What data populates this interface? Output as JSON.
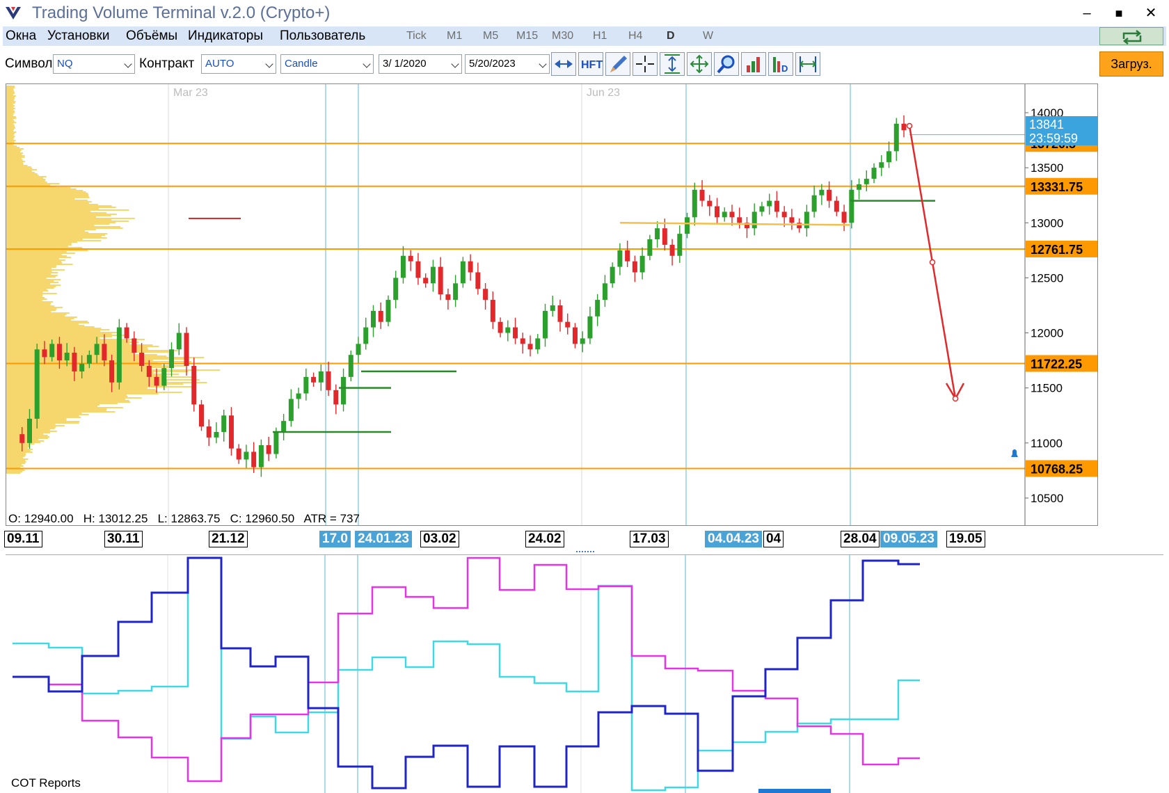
{
  "window": {
    "title": "Trading Volume Terminal v.2.0 (Crypto+)",
    "minimize": "–",
    "maximize": "■",
    "close": "✕"
  },
  "menu": {
    "items": [
      "Окна",
      "Установки",
      "Объёмы",
      "Индикаторы",
      "Пользователь"
    ],
    "timeframes": [
      "Tick",
      "M1",
      "M5",
      "M15",
      "M30",
      "H1",
      "H4",
      "D",
      "W"
    ],
    "active_timeframe": "D"
  },
  "toolbar": {
    "symbol_label": "Символ",
    "symbol_value": "NQ",
    "contract_label": "Контракт",
    "contract_value": "AUTO",
    "chart_type": "Candle",
    "date_from": "3/  1/2020",
    "date_to": "5/20/2023",
    "hft_label": "HFT",
    "load_button": "Загруз.",
    "tool_icons": [
      "replay-icon",
      "hft-icon",
      "pencil-icon",
      "crosshair-icon",
      "vertical-fit-icon",
      "move-icon",
      "zoom-icon",
      "volume-bars-icon",
      "delta-icon",
      "measure-icon"
    ]
  },
  "colors": {
    "up": "#2ca02c",
    "down": "#e2282b",
    "level": "#ff9900",
    "profile": "#f5d76e",
    "cursor_line": "#5bb7d6",
    "series_navy": "#1f24c7",
    "series_magenta": "#e633e6",
    "series_cyan": "#3fd8e6"
  },
  "main_chart": {
    "month_labels": [
      "Mar 23",
      "Jun 23"
    ],
    "y_ticks": [
      14000,
      13500,
      13000,
      12500,
      12000,
      11500,
      11000,
      10500
    ],
    "level_labels": [
      {
        "value": 13720.5,
        "text": "13720.5"
      },
      {
        "value": 13331.75,
        "text": "13331.75"
      },
      {
        "value": 12761.75,
        "text": "12761.75"
      },
      {
        "value": 11722.25,
        "text": "11722.25"
      },
      {
        "value": 10768.25,
        "text": "10768.25"
      }
    ],
    "price_tag": {
      "price": "13841",
      "time": "23:59:59"
    },
    "ohlc": {
      "open_label": "O:",
      "open": "12940.00",
      "high_label": "H:",
      "high": "13012.25",
      "low_label": "L:",
      "low": "12863.75",
      "close_label": "C:",
      "close": "12960.50",
      "atr_label": "ATR =",
      "atr": "737"
    },
    "candle_closes": [
      11080,
      11000,
      11220,
      11850,
      11780,
      11900,
      11750,
      11820,
      11650,
      11720,
      11800,
      11900,
      11750,
      11550,
      12050,
      11950,
      11820,
      11700,
      11600,
      11520,
      11680,
      11850,
      12000,
      11700,
      11350,
      11150,
      11050,
      11100,
      11250,
      10950,
      10850,
      10920,
      10780,
      10980,
      10900,
      11100,
      11200,
      11400,
      11450,
      11600,
      11550,
      11650,
      11480,
      11350,
      11600,
      11800,
      11900,
      12050,
      12200,
      12100,
      12300,
      12500,
      12700,
      12650,
      12500,
      12450,
      12600,
      12350,
      12300,
      12450,
      12650,
      12550,
      12400,
      12300,
      12100,
      12000,
      12050,
      11950,
      11900,
      11850,
      11950,
      12200,
      12250,
      12100,
      12050,
      11900,
      11950,
      12150,
      12300,
      12450,
      12600,
      12750,
      12650,
      12550,
      12700,
      12850,
      12950,
      12800,
      12700,
      12900,
      13050,
      13300,
      13200,
      13150,
      13050,
      13100,
      13050,
      13000,
      12950,
      13100,
      13150,
      13200,
      13100,
      13050,
      13000,
      12950,
      13100,
      13250,
      13300,
      13200,
      13100,
      13000,
      13300,
      13350,
      13400,
      13500,
      13550,
      13650,
      13900,
      13841
    ]
  },
  "date_strip": [
    {
      "text": "09.11",
      "hl": false
    },
    {
      "text": "30.11",
      "hl": false
    },
    {
      "text": "21.12",
      "hl": false
    },
    {
      "text": "17.0",
      "hl": true
    },
    {
      "text": "24.01.23",
      "hl": true
    },
    {
      "text": "03.02",
      "hl": false
    },
    {
      "text": "24.02",
      "hl": false
    },
    {
      "text": "17.03",
      "hl": false
    },
    {
      "text": "04.04.23",
      "hl": true
    },
    {
      "text": "04",
      "hl": false
    },
    {
      "text": "28.04",
      "hl": false
    },
    {
      "text": "09.05.23",
      "hl": true
    },
    {
      "text": "19.05",
      "hl": false
    }
  ],
  "cot_panel": {
    "label": "COT Reports"
  }
}
